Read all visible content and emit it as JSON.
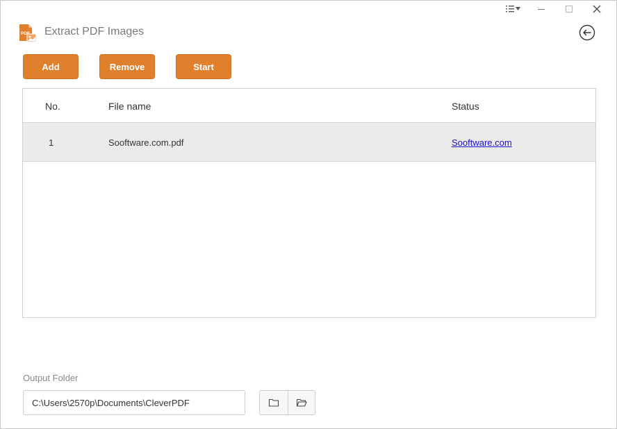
{
  "app": {
    "title": "Extract PDF Images",
    "logo_text": "PDF",
    "accent_color": "#e07f2c"
  },
  "window_controls": {
    "icons": [
      "menu-icon",
      "minimize-icon",
      "maximize-icon",
      "close-icon"
    ]
  },
  "toolbar": {
    "add_label": "Add",
    "remove_label": "Remove",
    "start_label": "Start"
  },
  "table": {
    "columns": [
      "No.",
      "File name",
      "Status"
    ],
    "rows": [
      {
        "no": "1",
        "file_name": "Sooftware.com.pdf",
        "status": "Sooftware.com"
      }
    ]
  },
  "output": {
    "label": "Output Folder",
    "path": "C:\\Users\\2570p\\Documents\\CleverPDF",
    "icons": [
      "folder-icon",
      "open-folder-icon"
    ]
  }
}
